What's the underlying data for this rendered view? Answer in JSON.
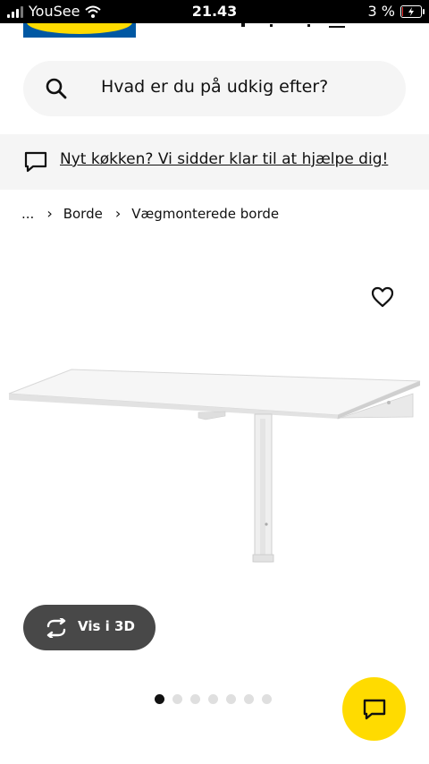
{
  "status_bar": {
    "carrier": "YouSee",
    "time": "21.43",
    "battery_percent": "3 %",
    "battery_level": 0.03
  },
  "search": {
    "placeholder": "Hvad er du på udkig efter?",
    "icon": "search-icon"
  },
  "help_banner": {
    "text": "Nyt køkken? Vi sidder klar til at hjælpe dig!",
    "icon": "chat-bubble-icon"
  },
  "breadcrumb": {
    "ellipsis": "...",
    "items": [
      "Borde",
      "Vægmonterede borde"
    ]
  },
  "product": {
    "view_3d_label": "Vis i 3D",
    "image_count": 7,
    "active_image": 0
  },
  "colors": {
    "brand_blue": "#0058a3",
    "brand_yellow": "#ffdb00",
    "button_dark": "#484848",
    "surface_gray": "#f5f5f5"
  }
}
